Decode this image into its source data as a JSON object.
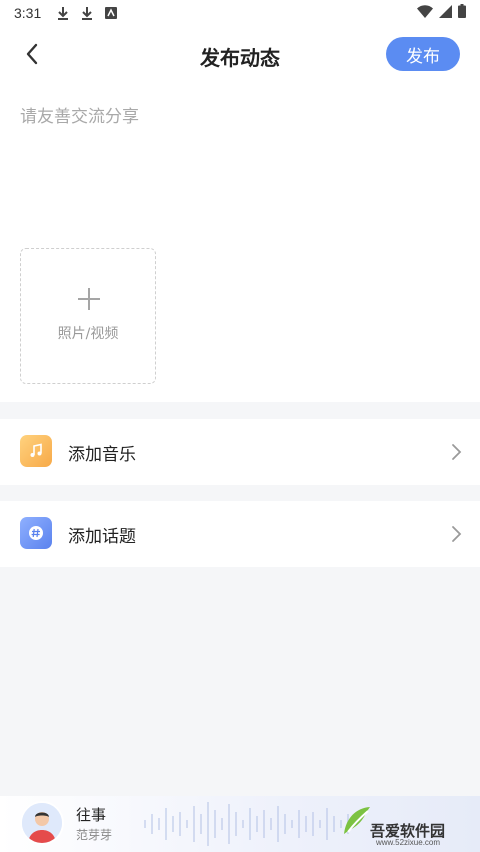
{
  "status_bar": {
    "time": "3:31"
  },
  "header": {
    "title": "发布动态",
    "publish_label": "发布"
  },
  "compose": {
    "placeholder": "请友善交流分享",
    "media_label": "照片/视频"
  },
  "options": {
    "music_label": "添加音乐",
    "topic_label": "添加话题"
  },
  "player": {
    "title": "往事",
    "artist": "范芽芽"
  },
  "watermark": {
    "text": "吾爱软件园",
    "url": "www.52zixue.com"
  },
  "colors": {
    "accent": "#5b8cf2",
    "music_icon": "#f7a948",
    "topic_icon": "#5a82ee",
    "background": "#f5f6f8"
  }
}
